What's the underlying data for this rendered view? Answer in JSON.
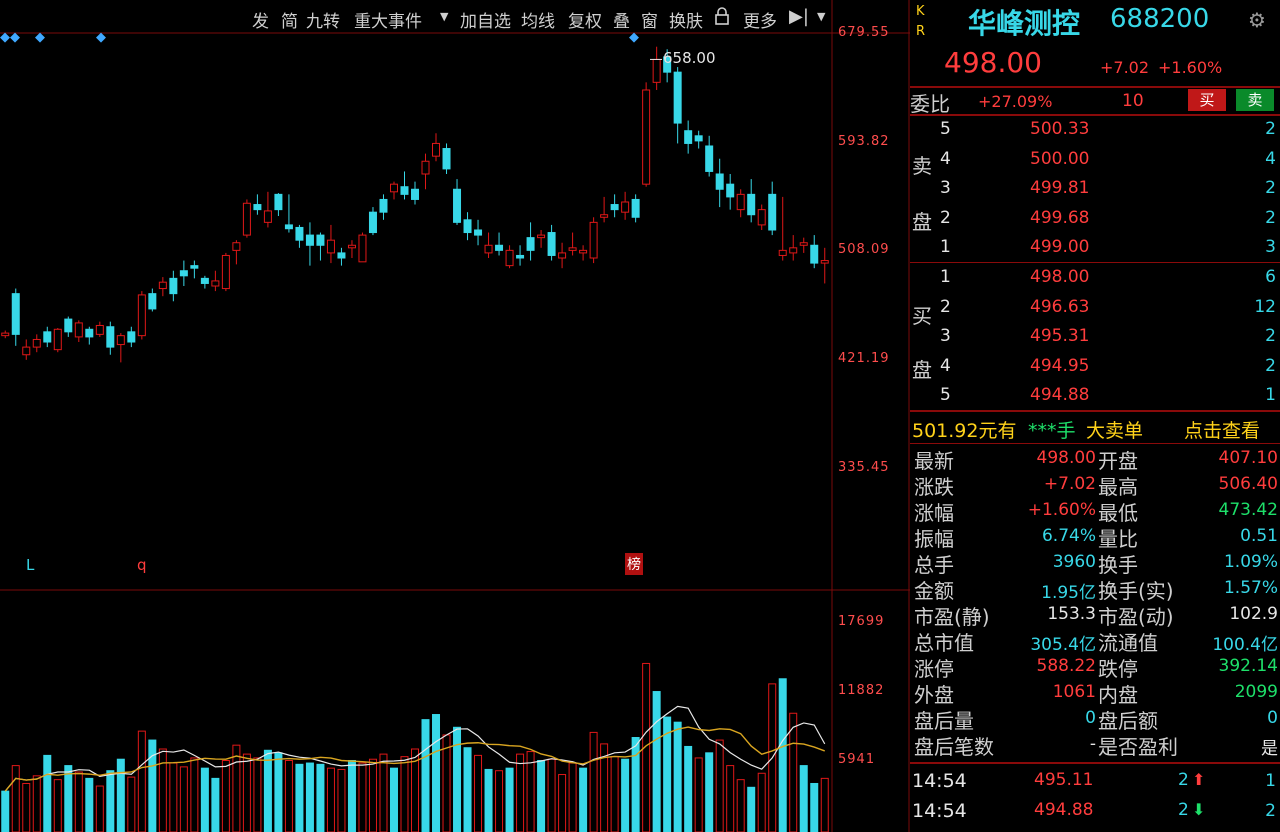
{
  "toolbar": {
    "items": [
      "发",
      "简",
      "九转",
      "重大事件",
      "加自选",
      "均线",
      "复权",
      "叠",
      "窗",
      "换肤",
      "更多"
    ]
  },
  "price_axis": [
    "679.55",
    "593.82",
    "508.09",
    "421.19",
    "335.45"
  ],
  "volume_axis": [
    "17699",
    "11882",
    "5941"
  ],
  "annotations": {
    "high_label": "658.00",
    "marker_l": "L",
    "marker_q": "q",
    "marker_bang": "榜"
  },
  "stock": {
    "kr_k": "K",
    "kr_r": "R",
    "name": "华峰测控",
    "code": "688200",
    "price": "498.00",
    "change": "+7.02",
    "change_pct": "+1.60%"
  },
  "weibi": {
    "label": "委比",
    "value": "+27.09%",
    "diff": "10",
    "buy_btn": "买",
    "sell_btn": "卖"
  },
  "sell_side_label": [
    "卖",
    "盘"
  ],
  "buy_side_label": [
    "买",
    "盘"
  ],
  "asks": [
    {
      "level": "5",
      "price": "500.33",
      "qty": "2"
    },
    {
      "level": "4",
      "price": "500.00",
      "qty": "4"
    },
    {
      "level": "3",
      "price": "499.81",
      "qty": "2"
    },
    {
      "level": "2",
      "price": "499.68",
      "qty": "2"
    },
    {
      "level": "1",
      "price": "499.00",
      "qty": "3"
    }
  ],
  "bids": [
    {
      "level": "1",
      "price": "498.00",
      "qty": "6"
    },
    {
      "level": "2",
      "price": "496.63",
      "qty": "12"
    },
    {
      "level": "3",
      "price": "495.31",
      "qty": "2"
    },
    {
      "level": "4",
      "price": "494.95",
      "qty": "2"
    },
    {
      "level": "5",
      "price": "494.88",
      "qty": "1"
    }
  ],
  "big_order": {
    "price_text": "501.92元有",
    "stars": "***手",
    "label": "大卖单",
    "action": "点击查看"
  },
  "stats": [
    {
      "l": "最新",
      "lv": "498.00",
      "lc": "red",
      "r": "开盘",
      "rv": "407.10",
      "rc": "red"
    },
    {
      "l": "涨跌",
      "lv": "+7.02",
      "lc": "red",
      "r": "最高",
      "rv": "506.40",
      "rc": "red"
    },
    {
      "l": "涨幅",
      "lv": "+1.60%",
      "lc": "red",
      "r": "最低",
      "rv": "473.42",
      "rc": "green"
    },
    {
      "l": "振幅",
      "lv": "6.74%",
      "lc": "cyan",
      "r": "量比",
      "rv": "0.51",
      "rc": "cyan"
    },
    {
      "l": "总手",
      "lv": "3960",
      "lc": "cyan",
      "r": "换手",
      "rv": "1.09%",
      "rc": "cyan"
    },
    {
      "l": "金额",
      "lv": "1.95亿",
      "lc": "cyan",
      "r": "换手(实)",
      "rv": "1.57%",
      "rc": "cyan"
    },
    {
      "l": "市盈(静)",
      "lv": "153.3",
      "lc": "white",
      "r": "市盈(动)",
      "rv": "102.9",
      "rc": "white"
    },
    {
      "l": "总市值",
      "lv": "305.4亿",
      "lc": "cyan",
      "r": "流通值",
      "rv": "100.4亿",
      "rc": "cyan"
    },
    {
      "l": "涨停",
      "lv": "588.22",
      "lc": "red",
      "r": "跌停",
      "rv": "392.14",
      "rc": "green"
    },
    {
      "l": "外盘",
      "lv": "1061",
      "lc": "red",
      "r": "内盘",
      "rv": "2099",
      "rc": "green"
    },
    {
      "l": "盘后量",
      "lv": "0",
      "lc": "cyan",
      "r": "盘后额",
      "rv": "0",
      "rc": "cyan"
    },
    {
      "l": "盘后笔数",
      "lv": "-",
      "lc": "white",
      "r": "是否盈利",
      "rv": "是",
      "rc": "white"
    }
  ],
  "ticks": [
    {
      "time": "14:54",
      "price": "495.11",
      "vol": "2",
      "dir": "up",
      "count": "1"
    },
    {
      "time": "14:54",
      "price": "494.88",
      "vol": "2",
      "dir": "down",
      "count": "2"
    }
  ],
  "colors": {
    "up": "#e01818",
    "down": "#38d8e8",
    "ma1": "#e8e8e8",
    "ma2": "#d9a520",
    "grid": "#7a0a0a"
  },
  "chart_data": {
    "type": "candlestick",
    "price_ylim": [
      335.45,
      679.55
    ],
    "price_ticks": [
      679.55,
      593.82,
      508.09,
      421.19,
      335.45
    ],
    "volume_ylim": [
      0,
      17699
    ],
    "volume_ticks": [
      17699,
      11882,
      5941
    ],
    "high_annotation": 658.0,
    "candles": [
      [
        441,
        445,
        439,
        443
      ],
      [
        474,
        478,
        433,
        442
      ],
      [
        426,
        438,
        422,
        432
      ],
      [
        432,
        442,
        428,
        438
      ],
      [
        444,
        448,
        432,
        436
      ],
      [
        430,
        447,
        428,
        446
      ],
      [
        454,
        456,
        440,
        444
      ],
      [
        440,
        453,
        436,
        451
      ],
      [
        446,
        448,
        434,
        440
      ],
      [
        442,
        452,
        440,
        449
      ],
      [
        448,
        452,
        426,
        432
      ],
      [
        434,
        443,
        420,
        441
      ],
      [
        444,
        448,
        432,
        436
      ],
      [
        441,
        476,
        438,
        473
      ],
      [
        474,
        478,
        460,
        462
      ],
      [
        478,
        487,
        472,
        483
      ],
      [
        486,
        492,
        468,
        474
      ],
      [
        492,
        500,
        480,
        488
      ],
      [
        496,
        500,
        486,
        494
      ],
      [
        486,
        488,
        478,
        482
      ],
      [
        480,
        492,
        476,
        484
      ],
      [
        478,
        506,
        476,
        504
      ],
      [
        508,
        516,
        497,
        514
      ],
      [
        520,
        548,
        518,
        545
      ],
      [
        544,
        552,
        536,
        540
      ],
      [
        530,
        554,
        526,
        539
      ],
      [
        552,
        553,
        535,
        540
      ],
      [
        528,
        552,
        522,
        525
      ],
      [
        526,
        528,
        510,
        516
      ],
      [
        520,
        530,
        496,
        512
      ],
      [
        520,
        522,
        500,
        512
      ],
      [
        506,
        528,
        498,
        516
      ],
      [
        506,
        510,
        496,
        502
      ],
      [
        510,
        516,
        502,
        512
      ],
      [
        499,
        522,
        500,
        520
      ],
      [
        538,
        542,
        520,
        522
      ],
      [
        548,
        552,
        532,
        538
      ],
      [
        554,
        562,
        548,
        560
      ],
      [
        558,
        570,
        548,
        552
      ],
      [
        556,
        562,
        544,
        548
      ],
      [
        568,
        584,
        556,
        578
      ],
      [
        582,
        600,
        578,
        592
      ],
      [
        588,
        592,
        568,
        572
      ],
      [
        556,
        564,
        528,
        530
      ],
      [
        532,
        538,
        516,
        522
      ],
      [
        524,
        532,
        512,
        520
      ],
      [
        506,
        522,
        502,
        512
      ],
      [
        512,
        522,
        504,
        508
      ],
      [
        496,
        512,
        494,
        508
      ],
      [
        504,
        512,
        496,
        502
      ],
      [
        518,
        530,
        500,
        508
      ],
      [
        518,
        524,
        510,
        520
      ],
      [
        522,
        528,
        500,
        504
      ],
      [
        502,
        514,
        494,
        506
      ],
      [
        508,
        522,
        504,
        510
      ],
      [
        506,
        512,
        500,
        508
      ],
      [
        502,
        534,
        498,
        530
      ],
      [
        534,
        550,
        530,
        536
      ],
      [
        544,
        552,
        534,
        540
      ],
      [
        538,
        554,
        532,
        546
      ],
      [
        548,
        552,
        530,
        534
      ],
      [
        560,
        640,
        558,
        634
      ],
      [
        640,
        668,
        634,
        658
      ],
      [
        660,
        666,
        640,
        648
      ],
      [
        648,
        652,
        592,
        608
      ],
      [
        602,
        610,
        584,
        592
      ],
      [
        598,
        602,
        588,
        594
      ],
      [
        590,
        598,
        566,
        570
      ],
      [
        568,
        580,
        542,
        556
      ],
      [
        560,
        568,
        540,
        550
      ],
      [
        540,
        556,
        534,
        552
      ],
      [
        552,
        564,
        530,
        536
      ],
      [
        528,
        544,
        524,
        540
      ],
      [
        552,
        562,
        520,
        524
      ],
      [
        504,
        550,
        500,
        508
      ],
      [
        506,
        520,
        500,
        510
      ],
      [
        512,
        518,
        506,
        514
      ],
      [
        512,
        520,
        494,
        498
      ],
      [
        498,
        510,
        482,
        500
      ]
    ],
    "volumes": [
      [
        3200,
        "down"
      ],
      [
        5200,
        "red"
      ],
      [
        3800,
        "red"
      ],
      [
        4400,
        "red"
      ],
      [
        6000,
        "down"
      ],
      [
        4100,
        "red"
      ],
      [
        5200,
        "down"
      ],
      [
        4700,
        "red"
      ],
      [
        4200,
        "down"
      ],
      [
        3600,
        "red"
      ],
      [
        4800,
        "down"
      ],
      [
        5700,
        "down"
      ],
      [
        4300,
        "red"
      ],
      [
        7900,
        "red"
      ],
      [
        7200,
        "down"
      ],
      [
        6500,
        "red"
      ],
      [
        5400,
        "red"
      ],
      [
        5100,
        "red"
      ],
      [
        5800,
        "red"
      ],
      [
        5000,
        "down"
      ],
      [
        4200,
        "down"
      ],
      [
        5600,
        "red"
      ],
      [
        6800,
        "red"
      ],
      [
        6100,
        "red"
      ],
      [
        5800,
        "red"
      ],
      [
        6400,
        "down"
      ],
      [
        6200,
        "down"
      ],
      [
        5600,
        "red"
      ],
      [
        5300,
        "down"
      ],
      [
        5400,
        "down"
      ],
      [
        5300,
        "down"
      ],
      [
        5000,
        "red"
      ],
      [
        4900,
        "red"
      ],
      [
        5600,
        "down"
      ],
      [
        5400,
        "red"
      ],
      [
        5700,
        "red"
      ],
      [
        6100,
        "red"
      ],
      [
        5000,
        "down"
      ],
      [
        5900,
        "red"
      ],
      [
        6500,
        "red"
      ],
      [
        8800,
        "down"
      ],
      [
        9200,
        "down"
      ],
      [
        7600,
        "red"
      ],
      [
        8200,
        "down"
      ],
      [
        6600,
        "down"
      ],
      [
        6000,
        "red"
      ],
      [
        4900,
        "down"
      ],
      [
        4800,
        "red"
      ],
      [
        5000,
        "down"
      ],
      [
        6100,
        "red"
      ],
      [
        6300,
        "red"
      ],
      [
        5600,
        "down"
      ],
      [
        5700,
        "red"
      ],
      [
        4500,
        "red"
      ],
      [
        5400,
        "red"
      ],
      [
        5000,
        "down"
      ],
      [
        7800,
        "red"
      ],
      [
        6900,
        "red"
      ],
      [
        5900,
        "red"
      ],
      [
        5700,
        "down"
      ],
      [
        7400,
        "down"
      ],
      [
        13200,
        "red"
      ],
      [
        11000,
        "down"
      ],
      [
        9000,
        "down"
      ],
      [
        8600,
        "down"
      ],
      [
        6700,
        "down"
      ],
      [
        5800,
        "red"
      ],
      [
        6200,
        "down"
      ],
      [
        7200,
        "red"
      ],
      [
        5200,
        "red"
      ],
      [
        4100,
        "red"
      ],
      [
        3500,
        "down"
      ],
      [
        4600,
        "red"
      ],
      [
        11600,
        "red"
      ],
      [
        12000,
        "down"
      ],
      [
        9300,
        "red"
      ],
      [
        5200,
        "down"
      ],
      [
        3800,
        "down"
      ],
      [
        4200,
        "red"
      ]
    ]
  }
}
